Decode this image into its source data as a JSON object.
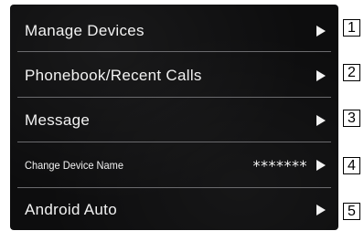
{
  "menu": {
    "items": [
      {
        "label": "Manage Devices",
        "value": ""
      },
      {
        "label": "Phonebook/Recent Calls",
        "value": ""
      },
      {
        "label": "Message",
        "value": ""
      },
      {
        "label": "Change Device Name",
        "value": "*******"
      },
      {
        "label": "Android Auto",
        "value": ""
      }
    ]
  },
  "callouts": [
    "1",
    "2",
    "3",
    "4",
    "5"
  ],
  "icons": {
    "row_arrow": "play-arrow-right-icon"
  },
  "colors": {
    "screen_background": "#0d0d0e",
    "text": "#f2f2f2",
    "divider": "#6b6b6e"
  }
}
